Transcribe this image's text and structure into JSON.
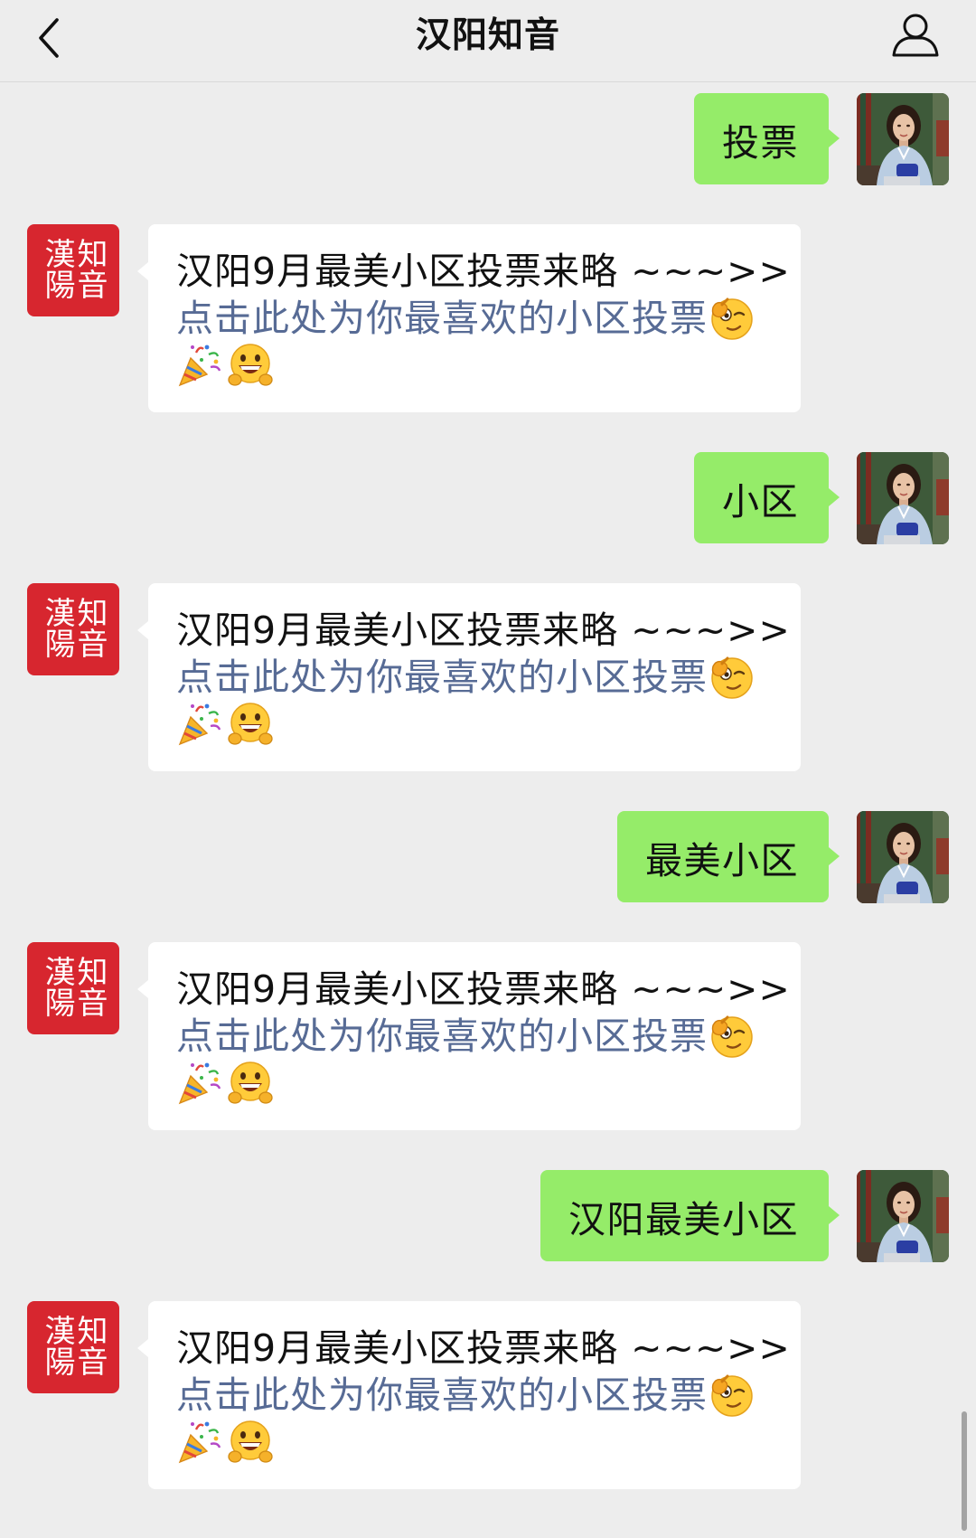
{
  "header": {
    "title": "汉阳知音",
    "back_icon": "chevron-left-icon",
    "profile_icon": "person-icon"
  },
  "official_account": {
    "logo_text": "漢陽知音"
  },
  "colors": {
    "background": "#EDEDED",
    "sent_bubble": "#95EC69",
    "received_bubble": "#FFFFFF",
    "link": "#576B95",
    "logo_red": "#D7262F"
  },
  "messages": [
    {
      "from": "me",
      "text": "投票"
    },
    {
      "from": "official",
      "line1": "汉阳9月最美小区投票来略 ~~~>>",
      "link": "点击此处为你最喜欢的小区投票",
      "emoji_line2": [
        "smart-wink-emoji"
      ],
      "emoji_line3": [
        "party-popper-emoji",
        "grin-hands-emoji"
      ]
    },
    {
      "from": "me",
      "text": "小区"
    },
    {
      "from": "official",
      "line1": "汉阳9月最美小区投票来略 ~~~>>",
      "link": "点击此处为你最喜欢的小区投票",
      "emoji_line2": [
        "smart-wink-emoji"
      ],
      "emoji_line3": [
        "party-popper-emoji",
        "grin-hands-emoji"
      ]
    },
    {
      "from": "me",
      "text": "最美小区"
    },
    {
      "from": "official",
      "line1": "汉阳9月最美小区投票来略 ~~~>>",
      "link": "点击此处为你最喜欢的小区投票",
      "emoji_line2": [
        "smart-wink-emoji"
      ],
      "emoji_line3": [
        "party-popper-emoji",
        "grin-hands-emoji"
      ]
    },
    {
      "from": "me",
      "text": "汉阳最美小区"
    },
    {
      "from": "official",
      "line1": "汉阳9月最美小区投票来略 ~~~>>",
      "link": "点击此处为你最喜欢的小区投票",
      "emoji_line2": [
        "smart-wink-emoji"
      ],
      "emoji_line3": [
        "party-popper-emoji",
        "grin-hands-emoji"
      ]
    }
  ]
}
